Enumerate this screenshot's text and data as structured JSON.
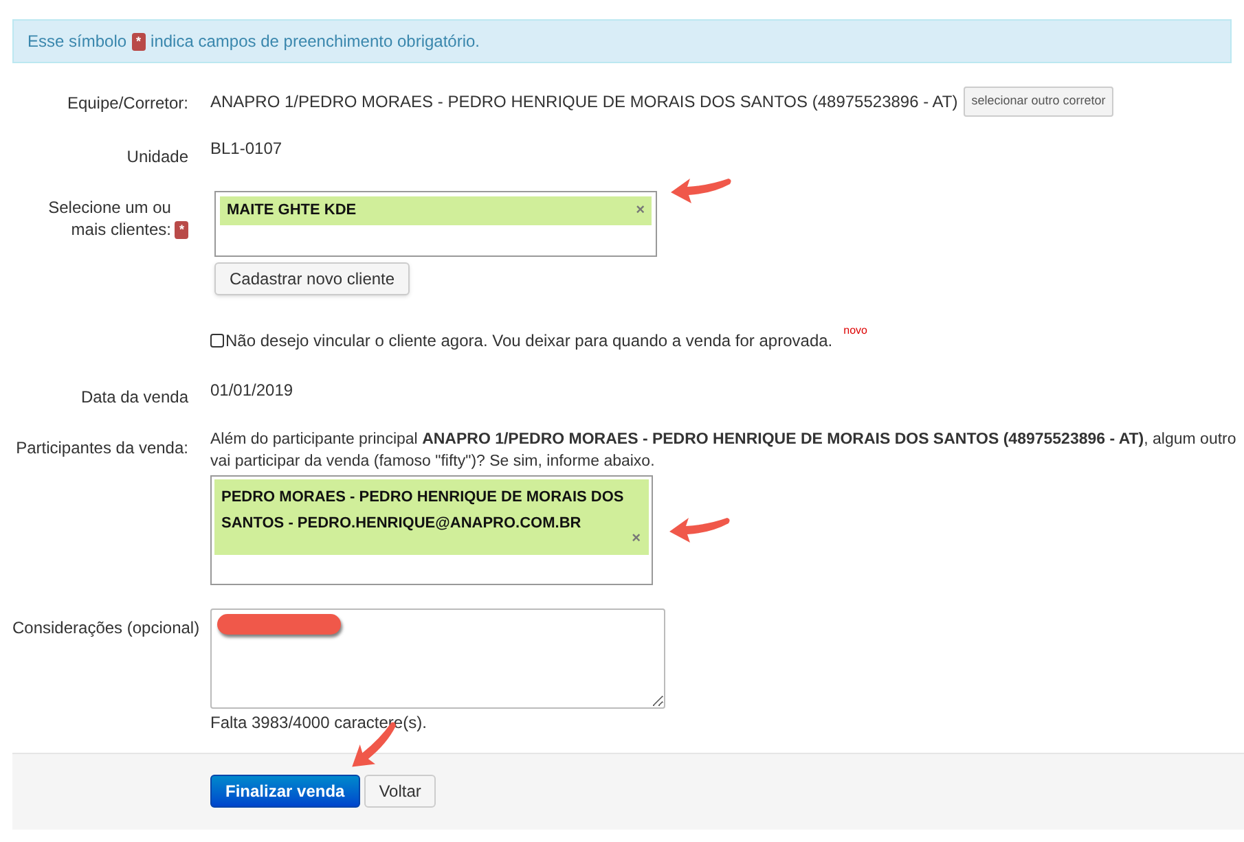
{
  "notice": {
    "before": "Esse símbolo",
    "mark": "*",
    "after": "indica campos de preenchimento obrigatório."
  },
  "broker": {
    "label": "Equipe/Corretor:",
    "value": "ANAPRO 1/PEDRO MORAES - PEDRO HENRIQUE DE MORAIS DOS SANTOS (48975523896 - AT)",
    "button": "selecionar outro corretor"
  },
  "unit": {
    "label": "Unidade",
    "value": "BL1-0107"
  },
  "clients": {
    "label": "Selecione um ou mais clientes:",
    "required_mark": "*",
    "selected": [
      {
        "text": "MAITE GHTE KDE",
        "remove": "×"
      }
    ],
    "button": "Cadastrar novo cliente"
  },
  "defer_option": {
    "label": "Não desejo vincular o cliente agora. Vou deixar para quando a venda for aprovada.",
    "checked": false,
    "badge": "novo"
  },
  "sale_date": {
    "label": "Data da venda",
    "value": "01/01/2019"
  },
  "participants": {
    "label": "Participantes da venda:",
    "intro": "Além do participante principal **ANAPRO 1/PEDRO MORAES - PEDRO HENRIQUE DE MORAIS DOS SANTOS (48975523896 - AT)**, algum outro vai participar da venda (famoso \"fifty\")? Se sim, informe abaixo.",
    "selected": [
      {
        "text": "PEDRO MORAES - PEDRO HENRIQUE DE MORAIS DOS SANTOS - PEDRO.HENRIQUE@ANAPRO.COM.BR",
        "remove": "×"
      }
    ]
  },
  "notes": {
    "label": "Considerações (opcional)",
    "counter": "Falta 3983/4000 caractere(s)."
  },
  "actions": [
    {
      "label": "Finalizar venda",
      "kind": "primary"
    },
    {
      "label": "Voltar",
      "kind": "default"
    }
  ]
}
